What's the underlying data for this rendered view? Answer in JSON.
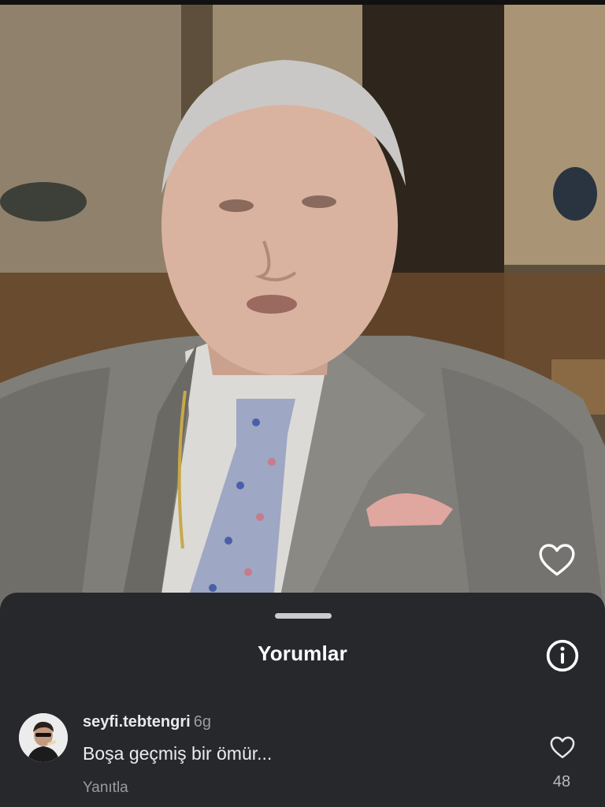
{
  "video": {
    "image_description": "Video frame of an elderly man with grey hair in a grey checked suit, spotted tie and pink pocket square",
    "like_icon": "heart-outline-icon"
  },
  "comments_sheet": {
    "title": "Yorumlar",
    "info_icon": "info-circle-icon",
    "comments": [
      {
        "username": "seyfi.tebtengri",
        "time": "6g",
        "text": "Boşa geçmiş bir ömür...",
        "reply_label": "Yanıtla",
        "like_icon": "heart-outline-icon",
        "like_count": "48"
      }
    ]
  },
  "colors": {
    "sheet_background": "#26282c",
    "primary_text": "#ffffff",
    "secondary_text": "#9a9ca2"
  }
}
